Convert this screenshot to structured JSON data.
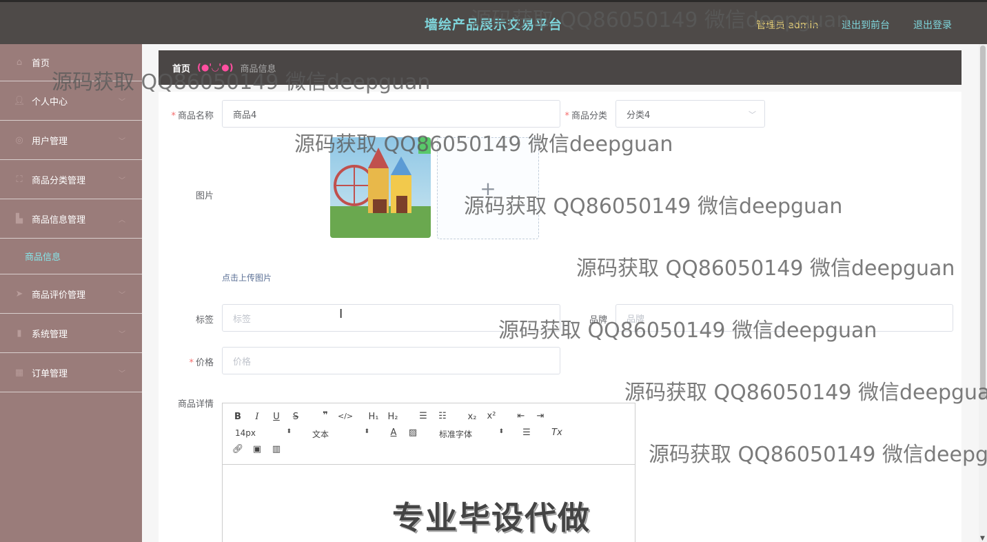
{
  "header": {
    "site_title": "墙绘产品展示交易平台",
    "admin_label": "管理员 admin",
    "to_front_label": "退出到前台",
    "logout_label": "退出登录"
  },
  "sidebar": {
    "items": [
      {
        "label": "首页",
        "icon": "home-icon"
      },
      {
        "label": "个人中心",
        "icon": "user-icon"
      },
      {
        "label": "用户管理",
        "icon": "globe-icon"
      },
      {
        "label": "商品分类管理",
        "icon": "frame-icon"
      },
      {
        "label": "商品信息管理",
        "icon": "box-icon",
        "expanded": true
      },
      {
        "label": "商品评价管理",
        "icon": "send-icon"
      },
      {
        "label": "系统管理",
        "icon": "bar-chart-icon"
      },
      {
        "label": "订单管理",
        "icon": "grid-icon"
      }
    ],
    "sub_item": "商品信息"
  },
  "breadcrumb": {
    "home": "首页",
    "separator": "(●'◡'●)",
    "current": "商品信息"
  },
  "form": {
    "name_label": "商品名称",
    "name_value": "商品4",
    "category_label": "商品分类",
    "category_value": "分类4",
    "image_label": "图片",
    "upload_tip": "点击上传图片",
    "tag_label": "标签",
    "tag_placeholder": "标签",
    "brand_label": "品牌",
    "brand_placeholder": "品牌",
    "price_label": "价格",
    "price_placeholder": "价格",
    "detail_label": "商品详情"
  },
  "editor": {
    "font_size": "14px",
    "text_type": "文本",
    "font_family": "标准字体",
    "banner_text": "专业毕设代做"
  },
  "watermark_text": "源码获取 QQ86050149 微信deepguan",
  "colors": {
    "header_bg": "#4e4a48",
    "sidebar_bg": "#9a7c7a",
    "accent": "#7fd6dc",
    "required": "#f56c6c"
  }
}
